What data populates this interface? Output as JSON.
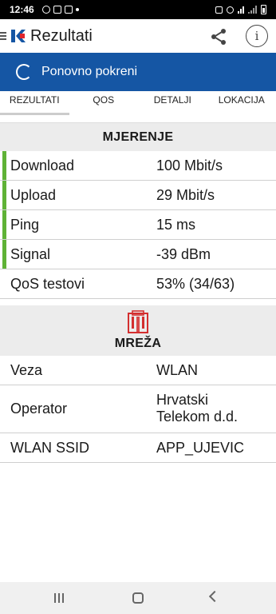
{
  "status_bar": {
    "time": "12:46"
  },
  "app_bar": {
    "title": "Rezultati"
  },
  "restart": {
    "label": "Ponovno pokreni"
  },
  "tabs": [
    {
      "label": "REZULTATI",
      "active": true
    },
    {
      "label": "QOS"
    },
    {
      "label": "DETALJI"
    },
    {
      "label": "LOKACIJA"
    }
  ],
  "measurement": {
    "title": "MJERENJE",
    "rows": [
      {
        "key": "Download",
        "value": "100 Mbit/s"
      },
      {
        "key": "Upload",
        "value": "29 Mbit/s"
      },
      {
        "key": "Ping",
        "value": "15 ms"
      },
      {
        "key": "Signal",
        "value": "-39 dBm"
      },
      {
        "key": "QoS testovi",
        "value": "53% (34/63)"
      }
    ]
  },
  "network": {
    "title": "MREŽA",
    "rows": [
      {
        "key": "Veza",
        "value": "WLAN"
      },
      {
        "key": "Operator",
        "value": "Hrvatski Telekom d.d."
      },
      {
        "key": "WLAN SSID",
        "value": "APP_UJEVIC"
      }
    ]
  },
  "colors": {
    "accent": "#1556a4",
    "good": "#5fb236",
    "logo_red": "#e0262c",
    "building": "#d32f2f"
  },
  "icons": {
    "share": "share-icon",
    "info": "info-icon",
    "restart": "refresh-spinner-icon",
    "network": "building-icon"
  }
}
